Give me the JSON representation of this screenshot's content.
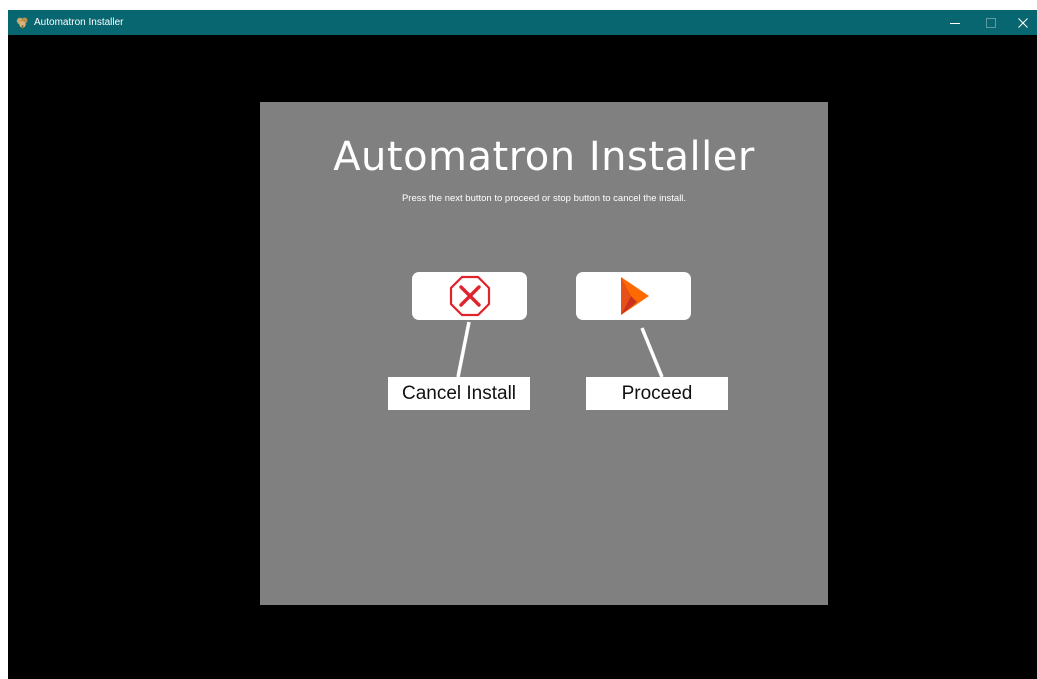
{
  "window": {
    "title": "Automatron Installer",
    "controls": [
      "minimize",
      "maximize",
      "close"
    ],
    "titlebar_color": "#076670",
    "icons": {
      "app": "app-icon",
      "minimize": "minimize-icon",
      "maximize": "maximize-icon",
      "close": "close-icon"
    }
  },
  "installer": {
    "title": "Automatron Installer",
    "instructions": "Press the next button to proceed or stop button to cancel the install.",
    "panel_color": "#808080",
    "buttons": {
      "cancel": {
        "icon": "stop-sign-x-icon",
        "icon_color": "#e0242c"
      },
      "proceed": {
        "icon": "play-arrow-icon",
        "icon_color": "#ff6a00"
      }
    },
    "callouts": {
      "cancel": "Cancel Install",
      "proceed": "Proceed"
    }
  }
}
